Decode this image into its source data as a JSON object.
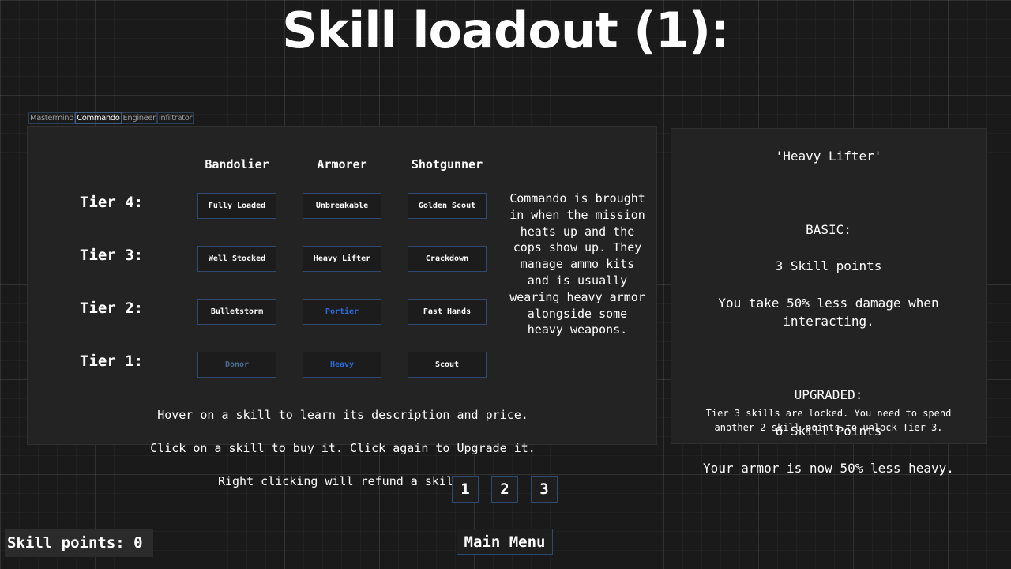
{
  "title": "Skill loadout (1):",
  "tabs": [
    {
      "label": "Mastermind",
      "active": false
    },
    {
      "label": "Commando",
      "active": true
    },
    {
      "label": "Engineer",
      "active": false
    },
    {
      "label": "Infiltrator",
      "active": false
    }
  ],
  "tree": {
    "columns": [
      "Bandolier",
      "Armorer",
      "Shotgunner"
    ],
    "tiers": [
      {
        "label": "Tier 4:",
        "skills": [
          {
            "name": "Fully Loaded",
            "state": "normal"
          },
          {
            "name": "Unbreakable",
            "state": "normal"
          },
          {
            "name": "Golden Scout",
            "state": "normal"
          }
        ]
      },
      {
        "label": "Tier 3:",
        "skills": [
          {
            "name": "Well Stocked",
            "state": "normal"
          },
          {
            "name": "Heavy Lifter",
            "state": "normal"
          },
          {
            "name": "Crackdown",
            "state": "normal"
          }
        ]
      },
      {
        "label": "Tier 2:",
        "skills": [
          {
            "name": "Bulletstorm",
            "state": "normal"
          },
          {
            "name": "Portier",
            "state": "purchased"
          },
          {
            "name": "Fast Hands",
            "state": "normal"
          }
        ]
      },
      {
        "label": "Tier 1:",
        "skills": [
          {
            "name": "Donor",
            "state": "basic"
          },
          {
            "name": "Heavy",
            "state": "purchased"
          },
          {
            "name": "Scout",
            "state": "normal"
          }
        ]
      }
    ],
    "class_description": "Commando is brought in when the mission heats up and the cops show up. They manage ammo kits and is usually wearing heavy armor alongside some heavy weapons.",
    "help_lines": [
      "Hover on a skill to learn its description and price.",
      "Click on a skill to buy it. Click again to Upgrade it.",
      "Right clicking will refund a skill."
    ]
  },
  "info": {
    "skill_name": "'Heavy Lifter'",
    "basic_header": "BASIC:",
    "basic_cost": "3 Skill points",
    "basic_desc": "You take 50% less damage when interacting.",
    "upgraded_header": "UPGRADED:",
    "upgraded_cost": "6 Skill Points",
    "upgraded_desc": "Your armor is now 50% less heavy.",
    "lock_message": "Tier 3 skills are locked. You need to spend another 2 skill points to unlock Tier 3."
  },
  "pages": [
    "1",
    "2",
    "3"
  ],
  "main_menu_label": "Main Menu",
  "skill_points_label": "Skill points: 0",
  "colors": {
    "background": "#1a1a1a",
    "panel": "#232323",
    "button_border": "#2e4a6e",
    "purchased_text": "#2a6ad6",
    "basic_text": "#4a6a90"
  }
}
